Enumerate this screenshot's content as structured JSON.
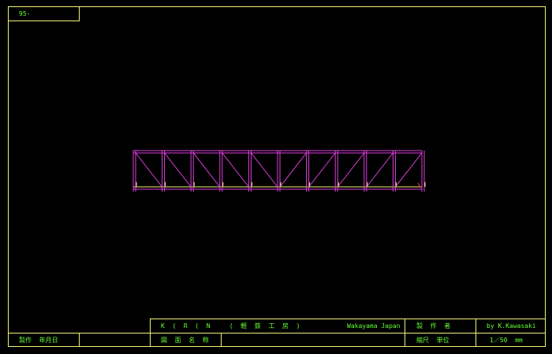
{
  "sheet": {
    "number": "95-",
    "colors": {
      "border": "#f2f27a",
      "text": "#66ff33",
      "truss": "#e040e0",
      "chord": "#f2f27a",
      "marker": "#ff4040"
    }
  },
  "titleblock": {
    "studio": "K  (  R  (  N     (  軽  鉄  工  房  )",
    "location": "Wakayama Japan",
    "author_label": "製  作  者",
    "author_value": "by K.Kawasaki",
    "date_label": "製作  年月日",
    "drawing_name_label": "図  面  名  称",
    "scale_label": "縮尺  単位",
    "scale_value": "1／50  mm"
  }
}
